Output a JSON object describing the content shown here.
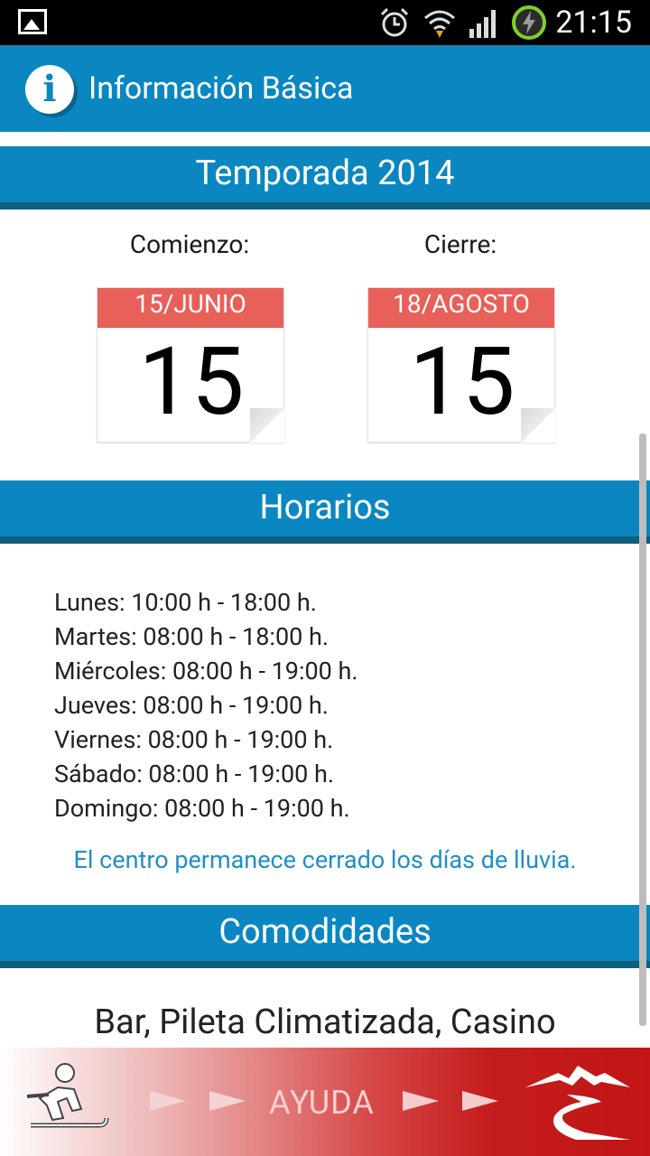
{
  "status_bar": {
    "time": "21:15",
    "icons": [
      "gallery-icon",
      "alarm-icon",
      "wifi-icon",
      "signal-icon",
      "battery-charging-icon"
    ]
  },
  "action_bar": {
    "title": "Información Básica",
    "icon": "info-icon"
  },
  "season": {
    "header": "Temporada 2014",
    "start": {
      "label": "Comienzo:",
      "month_label": "15/JUNIO",
      "day": "15"
    },
    "end": {
      "label": "Cierre:",
      "month_label": "18/AGOSTO",
      "day": "15"
    }
  },
  "hours": {
    "header": "Horarios",
    "rows": [
      "Lunes: 10:00 h - 18:00 h.",
      "Martes: 08:00 h - 18:00 h.",
      "Miércoles: 08:00 h - 19:00 h.",
      "Jueves: 08:00 h - 19:00 h.",
      "Viernes: 08:00 h - 19:00 h.",
      "Sábado: 08:00 h - 19:00 h.",
      "Domingo: 08:00 h - 19:00 h."
    ],
    "note": "El centro permanece cerrado los días de lluvia."
  },
  "amenities": {
    "header": "Comodidades",
    "text": "Bar, Pileta Climatizada, Casino"
  },
  "help_bar": {
    "label": "AYUDA",
    "left_icon": "sledding-icon",
    "right_icon": "mountain-logo-icon"
  },
  "colors": {
    "primary": "#0a87c1",
    "primary_dark": "#0c5f7d",
    "calendar_red": "#e8605a",
    "help_red": "#c31515",
    "link_blue": "#1f8fc6"
  }
}
